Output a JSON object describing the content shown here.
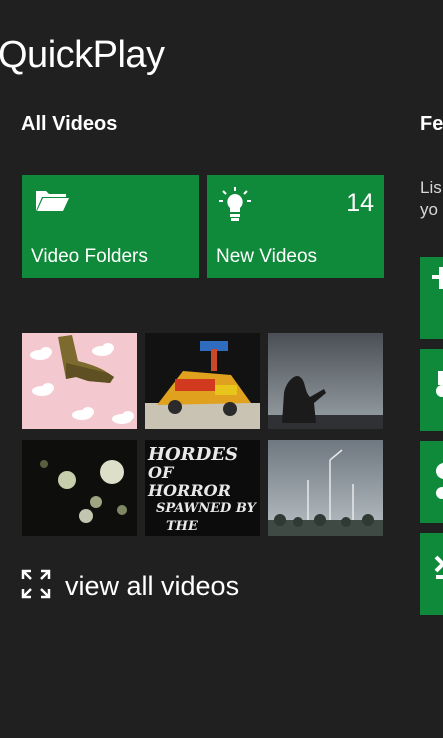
{
  "app": {
    "title": "QuickPlay"
  },
  "all_videos": {
    "section_title": "All Videos",
    "tiles": [
      {
        "label": "Video Folders",
        "icon": "folder-icon"
      },
      {
        "label": "New Videos",
        "icon": "lightbulb-icon",
        "count": "14"
      }
    ],
    "thumbnails": [
      {
        "name": "boot-on-clouds"
      },
      {
        "name": "lego-toy"
      },
      {
        "name": "bear-at-dusk"
      },
      {
        "name": "bokeh-lights"
      },
      {
        "name": "hordes-of-horror",
        "text_line1": "HORDES",
        "text_line2": "OF HORROR",
        "text_line3": "SPAWNED BY",
        "text_line4": "THE DEVIL..."
      },
      {
        "name": "windmills-sky"
      }
    ],
    "view_all": {
      "label": "view all videos",
      "icon": "expand-icon"
    }
  },
  "right_panel": {
    "title": "Fe",
    "description": "Lis\nyo"
  },
  "colors": {
    "background": "#1f201f",
    "accent": "#0f8a3a",
    "text": "#ffffff"
  }
}
